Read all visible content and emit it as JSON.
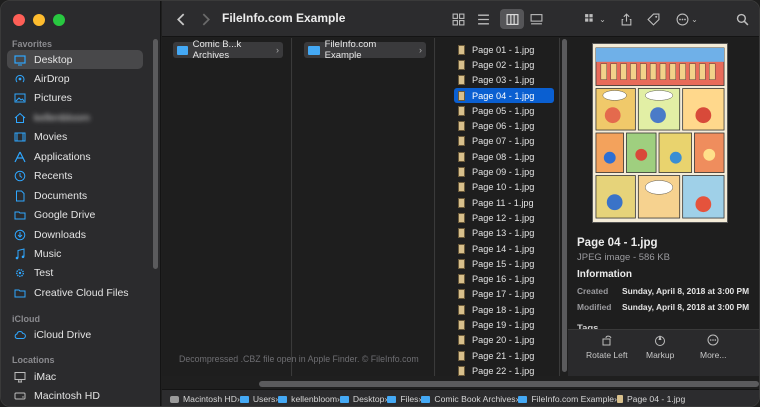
{
  "window": {
    "title": "FileInfo.com Example"
  },
  "sidebar": {
    "sections": {
      "favorites": "Favorites",
      "icloud": "iCloud",
      "locations": "Locations"
    },
    "favorites": [
      {
        "label": "Desktop",
        "icon": "desktop-icon",
        "active": true
      },
      {
        "label": "AirDrop",
        "icon": "airdrop-icon"
      },
      {
        "label": "Pictures",
        "icon": "pictures-icon"
      },
      {
        "label": "kellenbloom",
        "icon": "home-icon",
        "blurred": true
      },
      {
        "label": "Movies",
        "icon": "movies-icon"
      },
      {
        "label": "Applications",
        "icon": "applications-icon"
      },
      {
        "label": "Recents",
        "icon": "clock-icon"
      },
      {
        "label": "Documents",
        "icon": "document-icon"
      },
      {
        "label": "Google Drive",
        "icon": "folder-icon"
      },
      {
        "label": "Downloads",
        "icon": "downloads-icon"
      },
      {
        "label": "Music",
        "icon": "music-icon"
      },
      {
        "label": "Test",
        "icon": "gear-icon"
      },
      {
        "label": "Creative Cloud Files",
        "icon": "folder-icon"
      }
    ],
    "icloud": [
      {
        "label": "iCloud Drive",
        "icon": "cloud-icon"
      }
    ],
    "locations": [
      {
        "label": "iMac",
        "icon": "imac-icon"
      },
      {
        "label": "Macintosh HD",
        "icon": "disk-icon"
      }
    ]
  },
  "columns": {
    "col1_folder": "Comic B...k Archives",
    "col2_folder": "FileInfo.com Example",
    "files": [
      "Page 01 - 1.jpg",
      "Page 02 - 1.jpg",
      "Page 03 - 1.jpg",
      "Page 04 - 1.jpg",
      "Page 05 - 1.jpg",
      "Page 06 - 1.jpg",
      "Page 07 - 1.jpg",
      "Page 08 - 1.jpg",
      "Page 09 - 1.jpg",
      "Page 10 - 1.jpg",
      "Page 11 - 1.jpg",
      "Page 12 - 1.jpg",
      "Page 13 - 1.jpg",
      "Page 14 - 1.jpg",
      "Page 15 - 1.jpg",
      "Page 16 - 1.jpg",
      "Page 17 - 1.jpg",
      "Page 18 - 1.jpg",
      "Page 19 - 1.jpg",
      "Page 20 - 1.jpg",
      "Page 21 - 1.jpg",
      "Page 22 - 1.jpg"
    ],
    "selected_index": 3
  },
  "preview": {
    "name": "Page 04 - 1.jpg",
    "kind": "JPEG image - 586 KB",
    "info_heading": "Information",
    "created_label": "Created",
    "created_value": "Sunday, April 8, 2018 at 3:00 PM",
    "modified_label": "Modified",
    "modified_value": "Sunday, April 8, 2018 at 3:00 PM",
    "tags_heading": "Tags",
    "actions": [
      {
        "label": "Rotate Left",
        "icon": "rotate-left-icon"
      },
      {
        "label": "Markup",
        "icon": "markup-icon"
      },
      {
        "label": "More...",
        "icon": "more-icon"
      }
    ]
  },
  "watermark": "Decompressed .CBZ file open in Apple Finder. © FileInfo.com",
  "pathbar": [
    {
      "label": "Macintosh HD",
      "kind": "disk"
    },
    {
      "label": "Users",
      "kind": "folder"
    },
    {
      "label": "kellenbloom",
      "kind": "folder"
    },
    {
      "label": "Desktop",
      "kind": "folder"
    },
    {
      "label": "Files",
      "kind": "folder"
    },
    {
      "label": "Comic Book Archives",
      "kind": "folder"
    },
    {
      "label": "FileInfo.com Example",
      "kind": "folder"
    },
    {
      "label": "Page 04 - 1.jpg",
      "kind": "file"
    }
  ],
  "colors": {
    "accent": "#0a5fd1",
    "folder": "#44a9f5",
    "sidebar_icon": "#2fa7ff"
  }
}
